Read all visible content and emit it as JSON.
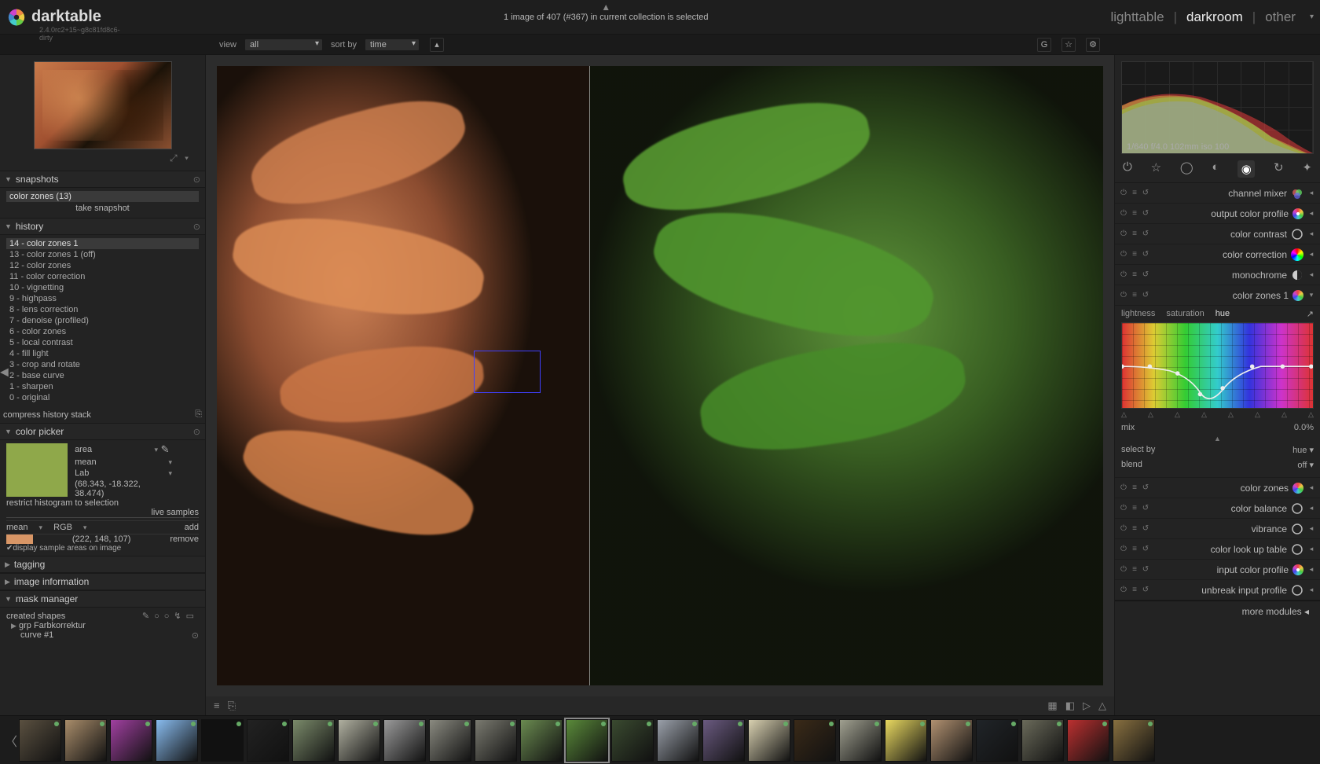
{
  "app": {
    "name": "darktable",
    "version": "2.4.0rc2+15~g8c81fd8c6-dirty",
    "status": "1 image of 407 (#367) in current collection is selected",
    "views": {
      "lighttable": "lighttable",
      "darkroom": "darkroom",
      "other": "other"
    }
  },
  "viewrow": {
    "view_label": "view",
    "view_value": "all",
    "sort_label": "sort by",
    "sort_value": "time"
  },
  "snapshots": {
    "title": "snapshots",
    "current": "color zones (13)",
    "button": "take snapshot"
  },
  "history": {
    "title": "history",
    "items": [
      "14 - color zones 1",
      "13 - color zones 1 (off)",
      "12 - color zones",
      "11 - color correction",
      "10 - vignetting",
      "9 - highpass",
      "8 - lens correction",
      "7 - denoise (profiled)",
      "6 - color zones",
      "5 - local contrast",
      "4 - fill light",
      "3 - crop and rotate",
      "2 - base curve",
      "1 - sharpen",
      "0 - original"
    ],
    "compress": "compress history stack"
  },
  "color_picker": {
    "title": "color picker",
    "mode": "area",
    "stat": "mean",
    "model": "Lab",
    "lab": "(68.343, -18.322, 38.474)",
    "restrict": "restrict histogram to selection",
    "live": "live samples",
    "add_stat": "mean",
    "add_model": "RGB",
    "add_label": "add",
    "rgb_val": "(222, 148, 107)",
    "remove": "remove",
    "display": "display sample areas on image"
  },
  "left_other": {
    "tagging": "tagging",
    "image_info": "image information",
    "mask": "mask manager",
    "shapes": "created shapes",
    "group": "grp Farbkorrektur",
    "curve": "curve #1"
  },
  "histogram": {
    "info": "1/640 f/4.0 102mm iso 100"
  },
  "modules": [
    {
      "name": "channel mixer",
      "icon": "mixer"
    },
    {
      "name": "output color profile",
      "icon": "profile"
    },
    {
      "name": "color contrast",
      "icon": "circle"
    },
    {
      "name": "color correction",
      "icon": "wheel"
    },
    {
      "name": "monochrome",
      "icon": "half"
    },
    {
      "name": "color zones 1",
      "icon": "zonewheel"
    }
  ],
  "colorzones": {
    "tabs": {
      "lightness": "lightness",
      "saturation": "saturation",
      "hue": "hue"
    },
    "mix_label": "mix",
    "mix_value": "0.0%",
    "select_label": "select by",
    "select_value": "hue",
    "blend_label": "blend",
    "blend_value": "off"
  },
  "modules_after": [
    {
      "name": "color zones",
      "icon": "zonewheel"
    },
    {
      "name": "color balance",
      "icon": "circle"
    },
    {
      "name": "vibrance",
      "icon": "circle"
    },
    {
      "name": "color look up table",
      "icon": "circle"
    },
    {
      "name": "input color profile",
      "icon": "profile"
    },
    {
      "name": "unbreak input profile",
      "icon": "circle"
    }
  ],
  "more_modules": "more modules",
  "filmstrip": {
    "thumbs": [
      {
        "c": "#5a5040"
      },
      {
        "c": "#a88c6a"
      },
      {
        "c": "#a040a0"
      },
      {
        "c": "#88bbee"
      },
      {
        "c": "#111"
      },
      {
        "c": "#222"
      },
      {
        "c": "#7a8a6a"
      },
      {
        "c": "#b0b0a0"
      },
      {
        "c": "#9a9a9a"
      },
      {
        "c": "#8a8a80"
      },
      {
        "c": "#7a7a70"
      },
      {
        "c": "#6a8a50"
      },
      {
        "c": "#5a8a3a",
        "sel": true
      },
      {
        "c": "#3a4a30"
      },
      {
        "c": "#9aa0aa"
      },
      {
        "c": "#6a5a80"
      },
      {
        "c": "#d8d0b0"
      },
      {
        "c": "#3a2a18"
      },
      {
        "c": "#a0a090"
      },
      {
        "c": "#e8d860"
      },
      {
        "c": "#b09070"
      },
      {
        "c": "#202428"
      },
      {
        "c": "#6a6a5a"
      },
      {
        "c": "#bb3030"
      },
      {
        "c": "#887040"
      }
    ]
  }
}
